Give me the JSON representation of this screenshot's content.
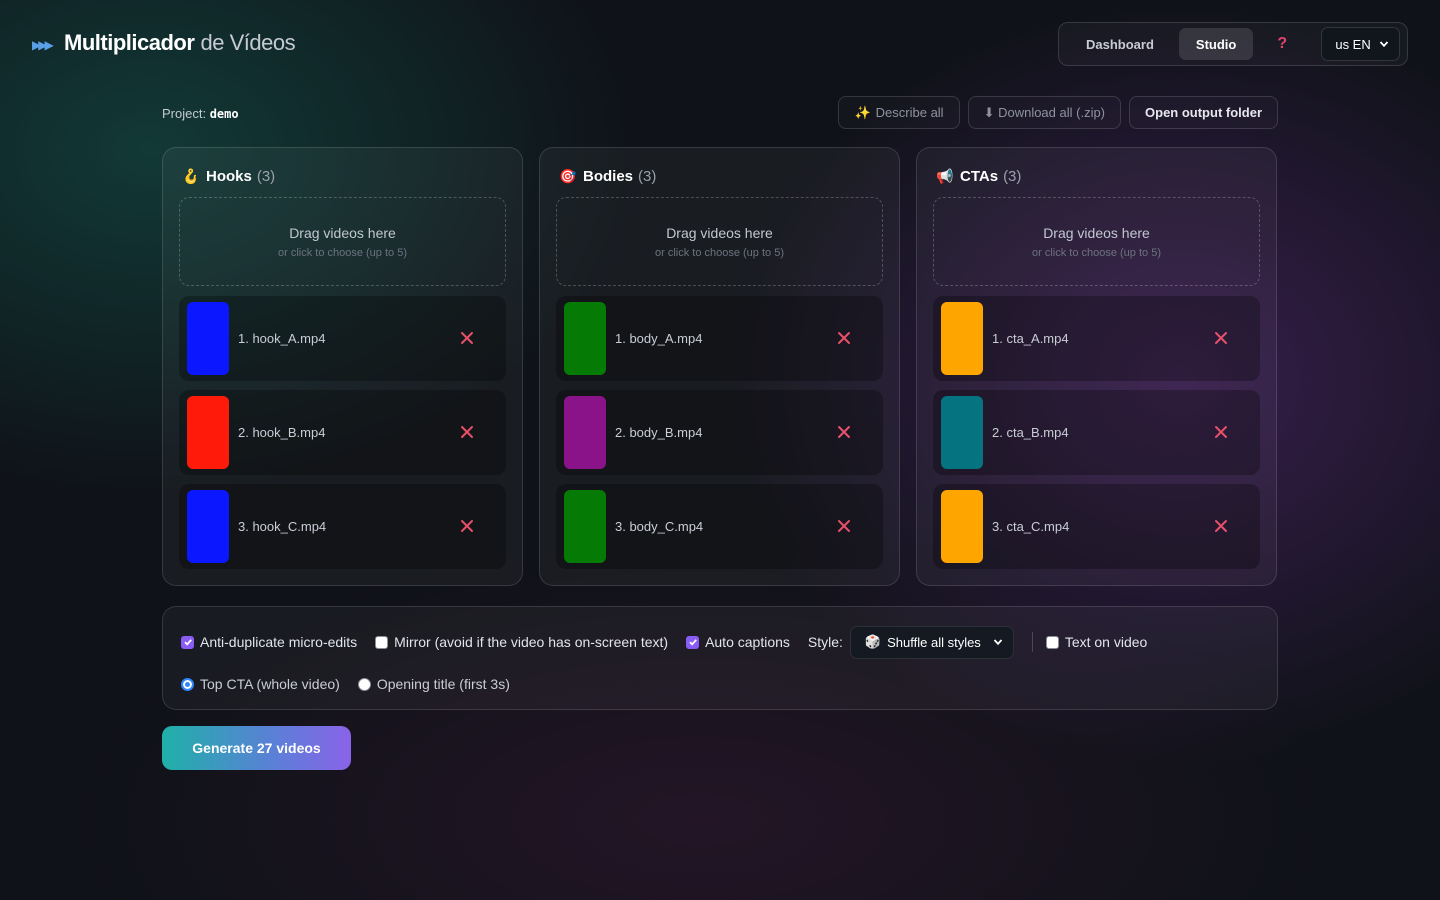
{
  "header": {
    "brand_icon": "fast-forward-icon",
    "brand_bold": "Multiplicador",
    "brand_light": "de Vídeos",
    "nav": {
      "dashboard": "Dashboard",
      "studio": "Studio",
      "help": "?"
    },
    "language": "us EN"
  },
  "project": {
    "label": "Project:",
    "name": "demo"
  },
  "actions": {
    "describe_all": "Describe all",
    "describe_icon": "sparkles-icon",
    "download_all": "⬇ Download all (.zip)",
    "open_output": "Open output folder"
  },
  "columns": [
    {
      "emoji": "🪝",
      "title": "Hooks",
      "count": "(3)",
      "drop_title": "Drag videos here",
      "drop_hint": "or click to choose (up to 5)",
      "clips": [
        {
          "name": "1. hook_A.mp4",
          "color": "#0a17ff"
        },
        {
          "name": "2. hook_B.mp4",
          "color": "#ff1a0a"
        },
        {
          "name": "3. hook_C.mp4",
          "color": "#0a17ff"
        }
      ]
    },
    {
      "emoji": "🎯",
      "title": "Bodies",
      "count": "(3)",
      "drop_title": "Drag videos here",
      "drop_hint": "or click to choose (up to 5)",
      "clips": [
        {
          "name": "1. body_A.mp4",
          "color": "#057a05"
        },
        {
          "name": "2. body_B.mp4",
          "color": "#8a138a"
        },
        {
          "name": "3. body_C.mp4",
          "color": "#057a05"
        }
      ]
    },
    {
      "emoji": "📢",
      "title": "CTAs",
      "count": "(3)",
      "drop_title": "Drag videos here",
      "drop_hint": "or click to choose (up to 5)",
      "clips": [
        {
          "name": "1. cta_A.mp4",
          "color": "#ffa500"
        },
        {
          "name": "2. cta_B.mp4",
          "color": "#057480"
        },
        {
          "name": "3. cta_C.mp4",
          "color": "#ffa500"
        }
      ]
    }
  ],
  "options": {
    "anti_duplicate": {
      "label": "Anti-duplicate micro-edits",
      "checked": true
    },
    "mirror": {
      "label": "Mirror (avoid if the video has on-screen text)",
      "checked": false
    },
    "auto_captions": {
      "label": "Auto captions",
      "checked": true
    },
    "style_label": "Style:",
    "style_value": "Shuffle all styles",
    "style_icon": "dice-icon",
    "text_on_video": {
      "label": "Text on video",
      "checked": false
    },
    "radio_top_cta": {
      "label": "Top CTA (whole video)",
      "selected": true
    },
    "radio_opening_title": {
      "label": "Opening title (first 3s)",
      "selected": false
    }
  },
  "generate_label": "Generate 27 videos",
  "colors": {
    "accent": "#8a5cf6",
    "remove": "#e8506a",
    "radio": "#2f86ff"
  }
}
